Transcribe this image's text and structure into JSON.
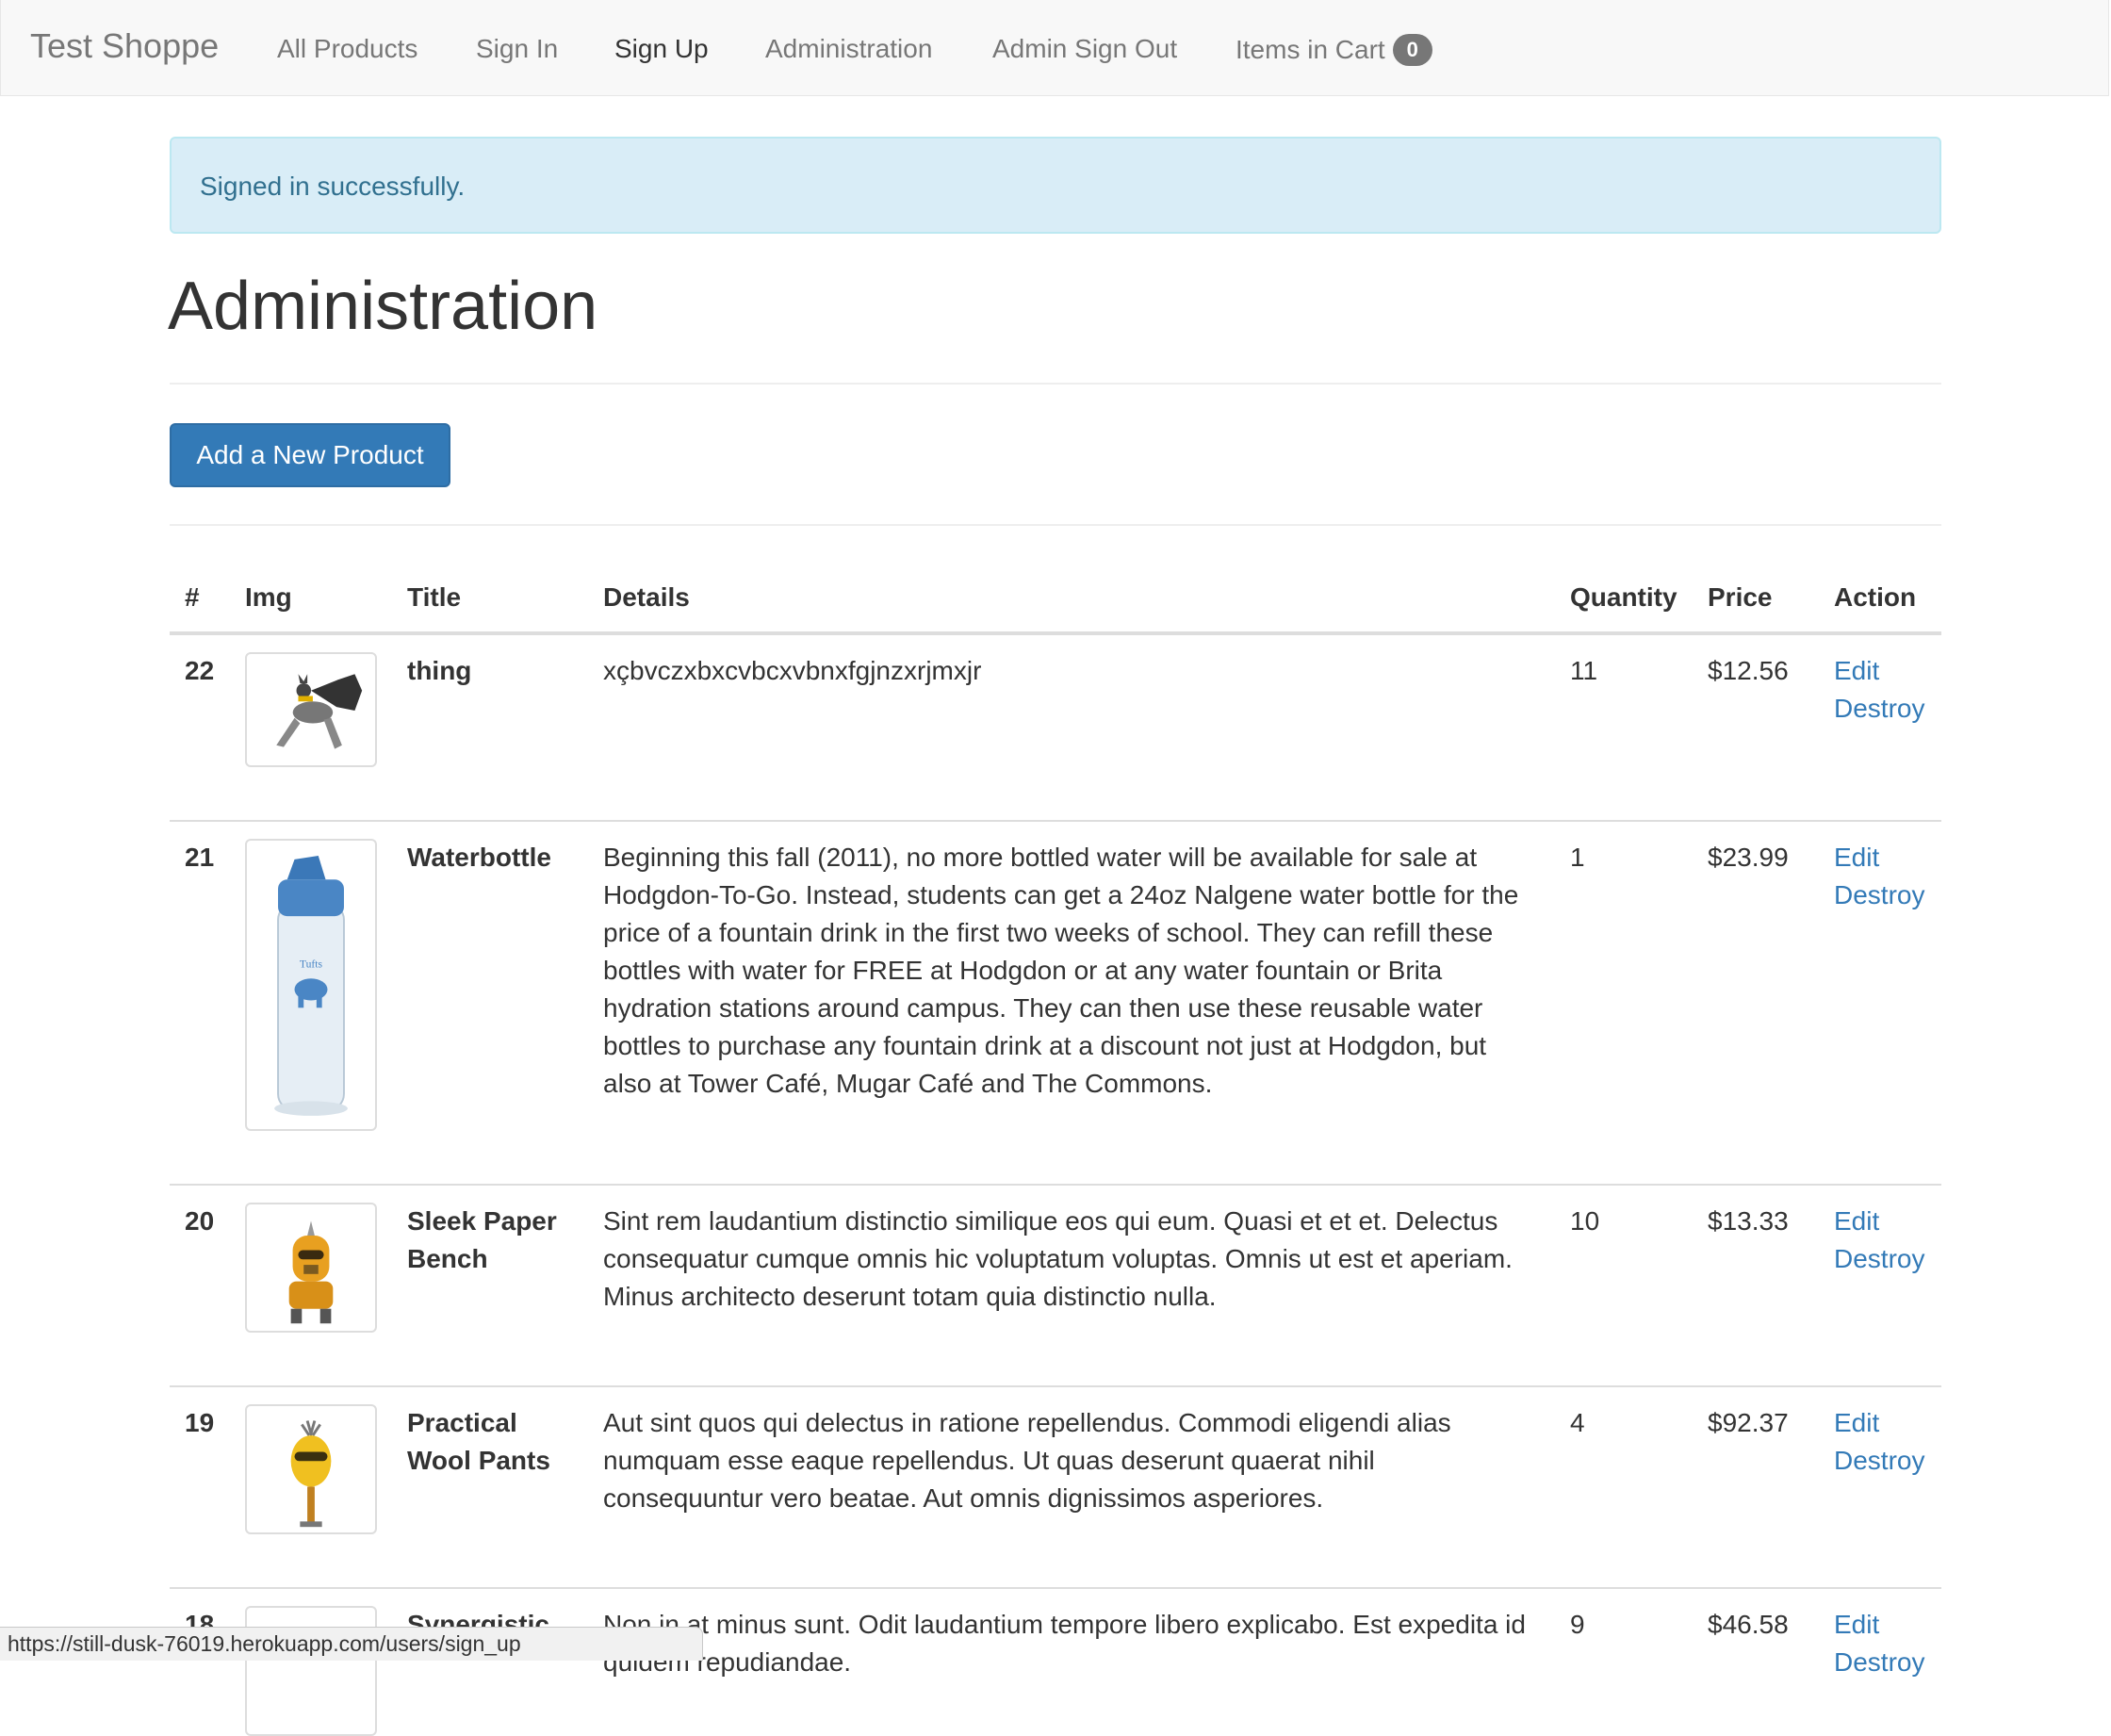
{
  "nav": {
    "brand": "Test Shoppe",
    "all_products": "All Products",
    "sign_in": "Sign In",
    "sign_up": "Sign Up",
    "administration": "Administration",
    "admin_sign_out": "Admin Sign Out",
    "items_in_cart": "Items in Cart",
    "cart_count": "0"
  },
  "alert": {
    "message": "Signed in successfully."
  },
  "page": {
    "title": "Administration",
    "add_button": "Add a New Product"
  },
  "table": {
    "headers": {
      "num": "#",
      "img": "Img",
      "title": "Title",
      "details": "Details",
      "quantity": "Quantity",
      "price": "Price",
      "action": "Action"
    },
    "edit_label": "Edit",
    "destroy_label": "Destroy",
    "rows": [
      {
        "id": "22",
        "image": "batman-griffin-icon",
        "title": "thing",
        "details": "xçbvczxbxcvbcxvbnxfgjnzxrjmxjr",
        "quantity": "11",
        "price": "$12.56"
      },
      {
        "id": "21",
        "image": "tufts-waterbottle-icon",
        "title": "Waterbottle",
        "details": "Beginning this fall (2011), no more bottled water will be available for sale at Hodgdon-To-Go. Instead, students can get a 24oz Nalgene water bottle for the price of a fountain drink in the first two weeks of school. They can refill these bottles with water for FREE at Hodgdon or at any water fountain or Brita hydration stations around campus. They can then use these reusable water bottles to purchase any fountain drink at a discount not just at Hodgdon, but also at Tower Café, Mugar Café and The Commons.",
        "quantity": "1",
        "price": "$23.99"
      },
      {
        "id": "20",
        "image": "orange-robot-icon",
        "title": "Sleek Paper Bench",
        "details": "Sint rem laudantium distinctio similique eos qui eum. Quasi et et et. Delectus consequatur cumque omnis hic voluptatum voluptas. Omnis ut est et aperiam. Minus architecto deserunt totam quia distinctio nulla.",
        "quantity": "10",
        "price": "$13.33"
      },
      {
        "id": "19",
        "image": "yellow-robot-icon",
        "title": "Practical Wool Pants",
        "details": "Aut sint quos qui delectus in ratione repellendus. Commodi eligendi alias numquam esse eaque repellendus. Ut quas deserunt quaerat nihil consequuntur vero beatae. Aut omnis dignissimos asperiores.",
        "quantity": "4",
        "price": "$92.37"
      },
      {
        "id": "18",
        "image": "robot-icon",
        "title": "Synergistic",
        "details": "Non in at minus sunt. Odit laudantium tempore libero explicabo. Est expedita id quidem repudiandae.",
        "quantity": "9",
        "price": "$46.58"
      }
    ]
  },
  "status_bar": {
    "url": "https://still-dusk-76019.herokuapp.com/users/sign_up"
  }
}
